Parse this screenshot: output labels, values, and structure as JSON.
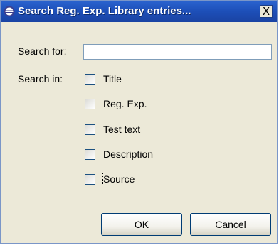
{
  "window": {
    "title": "Search Reg. Exp. Library entries...",
    "close_glyph": "X",
    "icon": "eclipse-icon"
  },
  "form": {
    "search_for_label": "Search for:",
    "search_value": "",
    "search_in_label": "Search in:"
  },
  "options": [
    {
      "label": "Title",
      "checked": false
    },
    {
      "label": "Reg. Exp.",
      "checked": false
    },
    {
      "label": "Test text",
      "checked": false
    },
    {
      "label": "Description",
      "checked": false
    },
    {
      "label": "Source",
      "checked": false
    }
  ],
  "buttons": {
    "ok_label": "OK",
    "cancel_label": "Cancel"
  }
}
